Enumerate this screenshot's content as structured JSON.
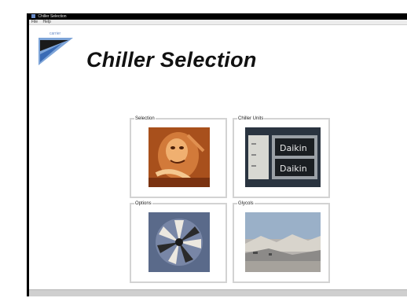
{
  "window": {
    "title": "Chiller Selection"
  },
  "menu": [
    {
      "label": "File"
    },
    {
      "label": "Help"
    }
  ],
  "logo": {
    "text": "carrier"
  },
  "page": {
    "title": "Chiller Selection"
  },
  "tiles": [
    {
      "label": "Selection"
    },
    {
      "label": "Chiller Units"
    },
    {
      "label": "Options"
    },
    {
      "label": "Glycols"
    }
  ],
  "chiller_panel_labels": [
    "Daikin",
    "Daikin"
  ],
  "colors": {
    "title_bar": "#000000",
    "logo_accent": "#6a8cc8",
    "tile_border": "#d3d3d3",
    "statusbar": "#cfcfcf"
  }
}
